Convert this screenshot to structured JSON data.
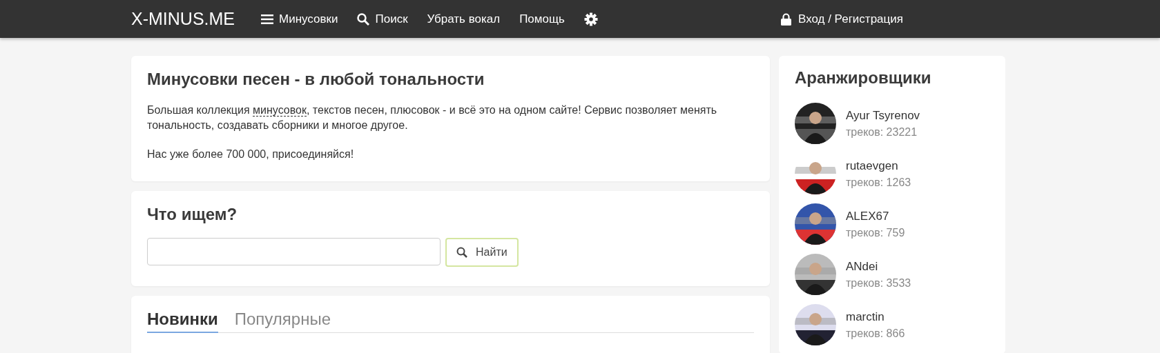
{
  "header": {
    "logo": "X-MINUS.ME",
    "nav": [
      {
        "kind": "menu",
        "label": "Минусовки"
      },
      {
        "kind": "search",
        "label": "Поиск"
      },
      {
        "kind": "plain",
        "label": "Убрать вокал"
      },
      {
        "kind": "plain",
        "label": "Помощь"
      },
      {
        "kind": "settings"
      }
    ],
    "login": "Вход / Регистрация"
  },
  "intro": {
    "title": "Минусовки песен - в любой тональности",
    "text_before": "Большая коллекция ",
    "link": "минусовок",
    "text_after": ", текстов песен, плюсовок - и всё это на одном сайте! Сервис позволяет менять тональность, создавать сборники и многое другое.",
    "note": "Нас уже более 700 000, присоединяйся!"
  },
  "search": {
    "title": "Что ищем?",
    "button": "Найти"
  },
  "tabs": [
    {
      "label": "Новинки",
      "selected": true
    },
    {
      "label": "Популярные",
      "selected": false
    }
  ],
  "sidebar": {
    "title": "Аранжировщики",
    "items": [
      {
        "name": "Ayur Tsyrenov",
        "tracks": "треков: 23221",
        "kind": "picture"
      },
      {
        "name": "rutaevgen",
        "tracks": "треков: 1263",
        "kind": "picture"
      },
      {
        "name": "ALEX67",
        "tracks": "треков: 759",
        "kind": "picture"
      },
      {
        "name": "ANdei",
        "tracks": "треков: 3533",
        "kind": "picture"
      },
      {
        "name": "marctin",
        "tracks": "треков: 866",
        "kind": "picture"
      }
    ]
  }
}
